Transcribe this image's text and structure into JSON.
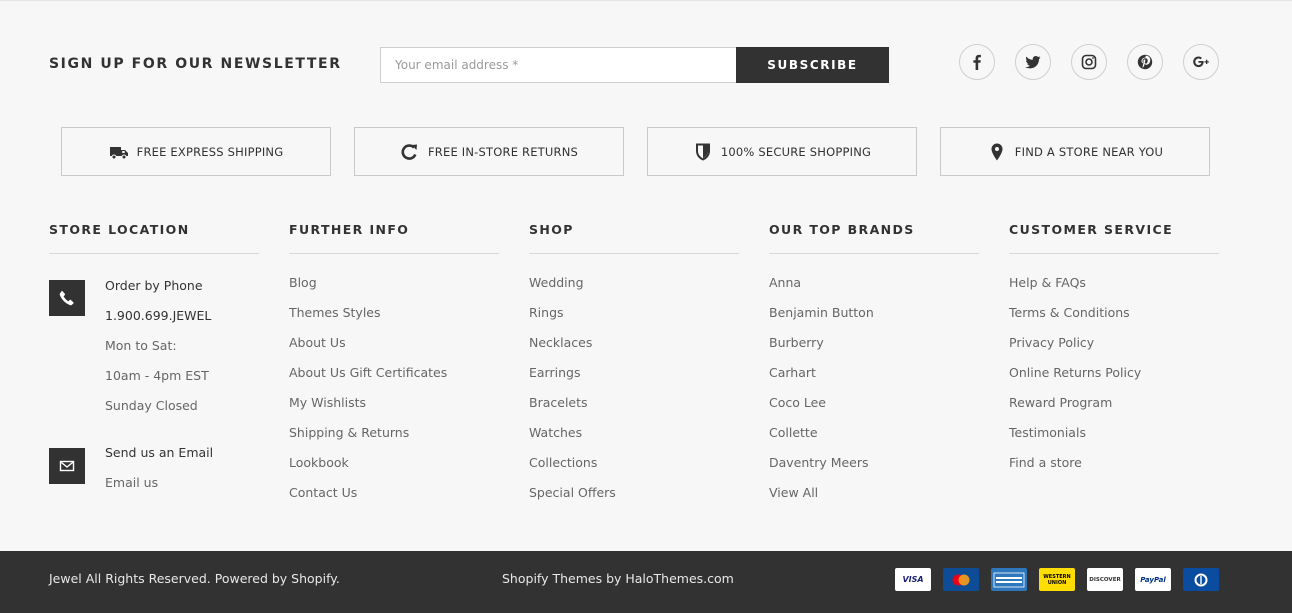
{
  "newsletter": {
    "title": "SIGN UP FOR OUR NEWSLETTER",
    "placeholder": "Your email address *",
    "button": "SUBSCRIBE"
  },
  "social": [
    "facebook-icon",
    "twitter-icon",
    "instagram-icon",
    "pinterest-icon",
    "google-plus-icon"
  ],
  "features": [
    {
      "label": "FREE EXPRESS SHIPPING",
      "icon": "truck-icon"
    },
    {
      "label": "FREE IN-STORE RETURNS",
      "icon": "refresh-icon"
    },
    {
      "label": "100% SECURE SHOPPING",
      "icon": "shield-icon"
    },
    {
      "label": "FIND A STORE NEAR YOU",
      "icon": "location-pin-icon"
    }
  ],
  "store_location": {
    "title": "STORE LOCATION",
    "phone_label": "Order by Phone",
    "phone_number": "1.900.699.JEWEL",
    "hours1": "Mon to Sat:",
    "hours2": "10am - 4pm EST",
    "hours3": "Sunday Closed",
    "email_label": "Send us an Email",
    "email_link": "Email us"
  },
  "further_info": {
    "title": "FURTHER INFO",
    "items": [
      "Blog",
      "Themes Styles",
      "About Us",
      "About Us Gift Certificates",
      "My Wishlists",
      "Shipping & Returns",
      "Lookbook",
      "Contact Us"
    ]
  },
  "shop": {
    "title": "SHOP",
    "items": [
      "Wedding",
      "Rings",
      "Necklaces",
      "Earrings",
      "Bracelets",
      "Watches",
      "Collections",
      "Special Offers"
    ]
  },
  "top_brands": {
    "title": "OUR TOP BRANDS",
    "items": [
      "Anna",
      "Benjamin Button",
      "Burberry",
      "Carhart",
      "Coco Lee",
      "Collette",
      "Daventry Meers",
      "View All"
    ]
  },
  "customer_service": {
    "title": "CUSTOMER SERVICE",
    "items": [
      "Help & FAQs",
      "Terms & Conditions",
      "Privacy Policy",
      "Online Returns Policy",
      "Reward Program",
      "Testimonials",
      "Find a store"
    ]
  },
  "footer": {
    "copyright": "Jewel All Rights Reserved. Powered by Shopify.",
    "credit": "Shopify Themes by HaloThemes.com",
    "payments": [
      {
        "name": "visa-icon",
        "label": "VISA"
      },
      {
        "name": "mastercard-icon",
        "label": ""
      },
      {
        "name": "american-express-icon",
        "label": ""
      },
      {
        "name": "western-union-icon",
        "label": "WESTERN UNION"
      },
      {
        "name": "discover-icon",
        "label": "DISCOVER"
      },
      {
        "name": "paypal-icon",
        "label": "PayPal"
      },
      {
        "name": "diners-club-icon",
        "label": ""
      }
    ]
  },
  "colors": {
    "background": "#f7f7f7",
    "dark": "#323232",
    "text": "#666666"
  }
}
